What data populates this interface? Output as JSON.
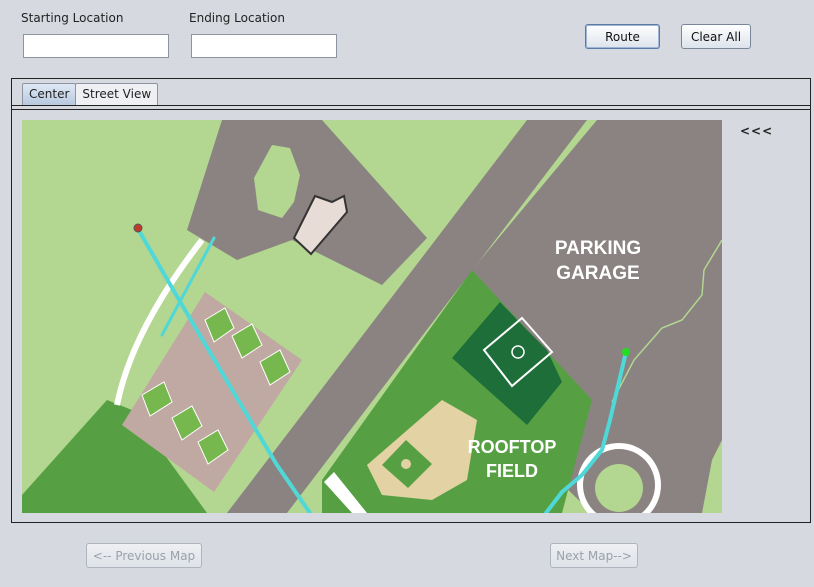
{
  "route_form": {
    "start_label": "Starting Location",
    "start_value": "",
    "end_label": "Ending Location",
    "end_value": "",
    "route_button": "Route",
    "clear_button": "Clear All"
  },
  "tabs": [
    {
      "label": "Center",
      "active": true
    },
    {
      "label": "Street View",
      "active": false
    }
  ],
  "map": {
    "labels": {
      "parking_line1": "PARKING",
      "parking_line2": "GARAGE",
      "rooftop_line1": "ROOFTOP",
      "rooftop_line2": "FIELD"
    },
    "colors": {
      "grass": "#b3d690",
      "road": "#8a8381",
      "field": "#56a043",
      "dark_field": "#1e6e3a",
      "tennis": "#c0a9a3",
      "court": "#76b84e",
      "infield": "#e3d2a4",
      "route": "#4fd8d8",
      "start_marker": "#c0392b",
      "end_marker": "#22dd22"
    }
  },
  "collapse_toggle": "<<<",
  "nav": {
    "previous": "<-- Previous Map",
    "next": "Next Map-->"
  }
}
